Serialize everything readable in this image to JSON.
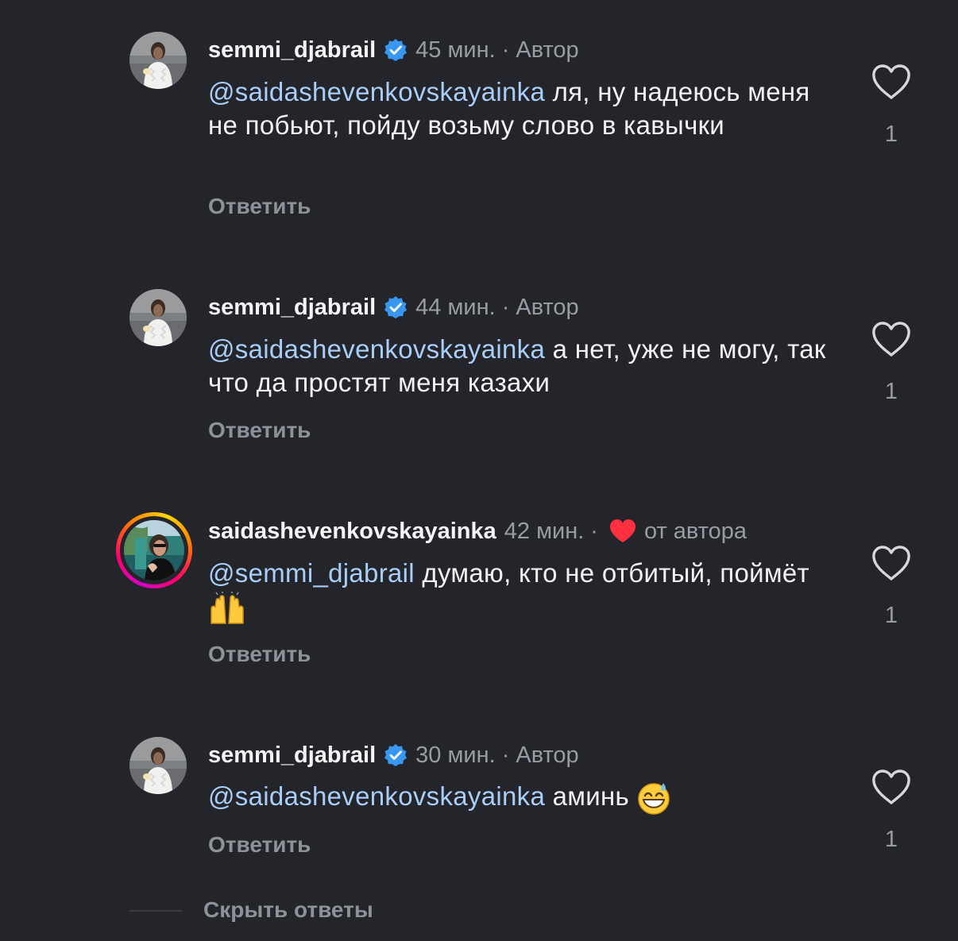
{
  "comments": [
    {
      "username": "semmi_djabrail",
      "verified": true,
      "time": "45 мин.",
      "badge": "Автор",
      "mention": "@saidashevenkovskayainka",
      "text": " ля, ну надеюсь меня не побьют, пойду возьму слово в кавычки",
      "reply_label": "Ответить",
      "likes": "1"
    },
    {
      "username": "semmi_djabrail",
      "verified": true,
      "time": "44 мин.",
      "badge": "Автор",
      "mention": "@saidashevenkovskayainka",
      "text": " а нет, уже не могу, так что да простят меня казахи",
      "reply_label": "Ответить",
      "likes": "1"
    },
    {
      "username": "saidashevenkovskayainka",
      "verified": false,
      "time": "42 мин.",
      "badge": "от автора",
      "liked_by_author": true,
      "mention": "@semmi_djabrail",
      "text": " думаю, кто не отбитый, поймёт",
      "emoji": "raising-hands",
      "reply_label": "Ответить",
      "likes": "1"
    },
    {
      "username": "semmi_djabrail",
      "verified": true,
      "time": "30 мин.",
      "badge": "Автор",
      "mention": "@saidashevenkovskayainka",
      "text": " аминь ",
      "emoji": "grinning-sweat",
      "reply_label": "Ответить",
      "likes": "1"
    }
  ],
  "hide_replies_label": "Скрыть ответы",
  "colors": {
    "background": "#23252a",
    "mention": "#a9cdf6",
    "secondary_text": "#9a9ca3",
    "verified_badge": "#3897f0",
    "author_heart": "#ff3040"
  },
  "icons": {
    "verified": "verified-badge-icon",
    "like": "heart-outline-icon",
    "author_like": "heart-filled-icon"
  }
}
